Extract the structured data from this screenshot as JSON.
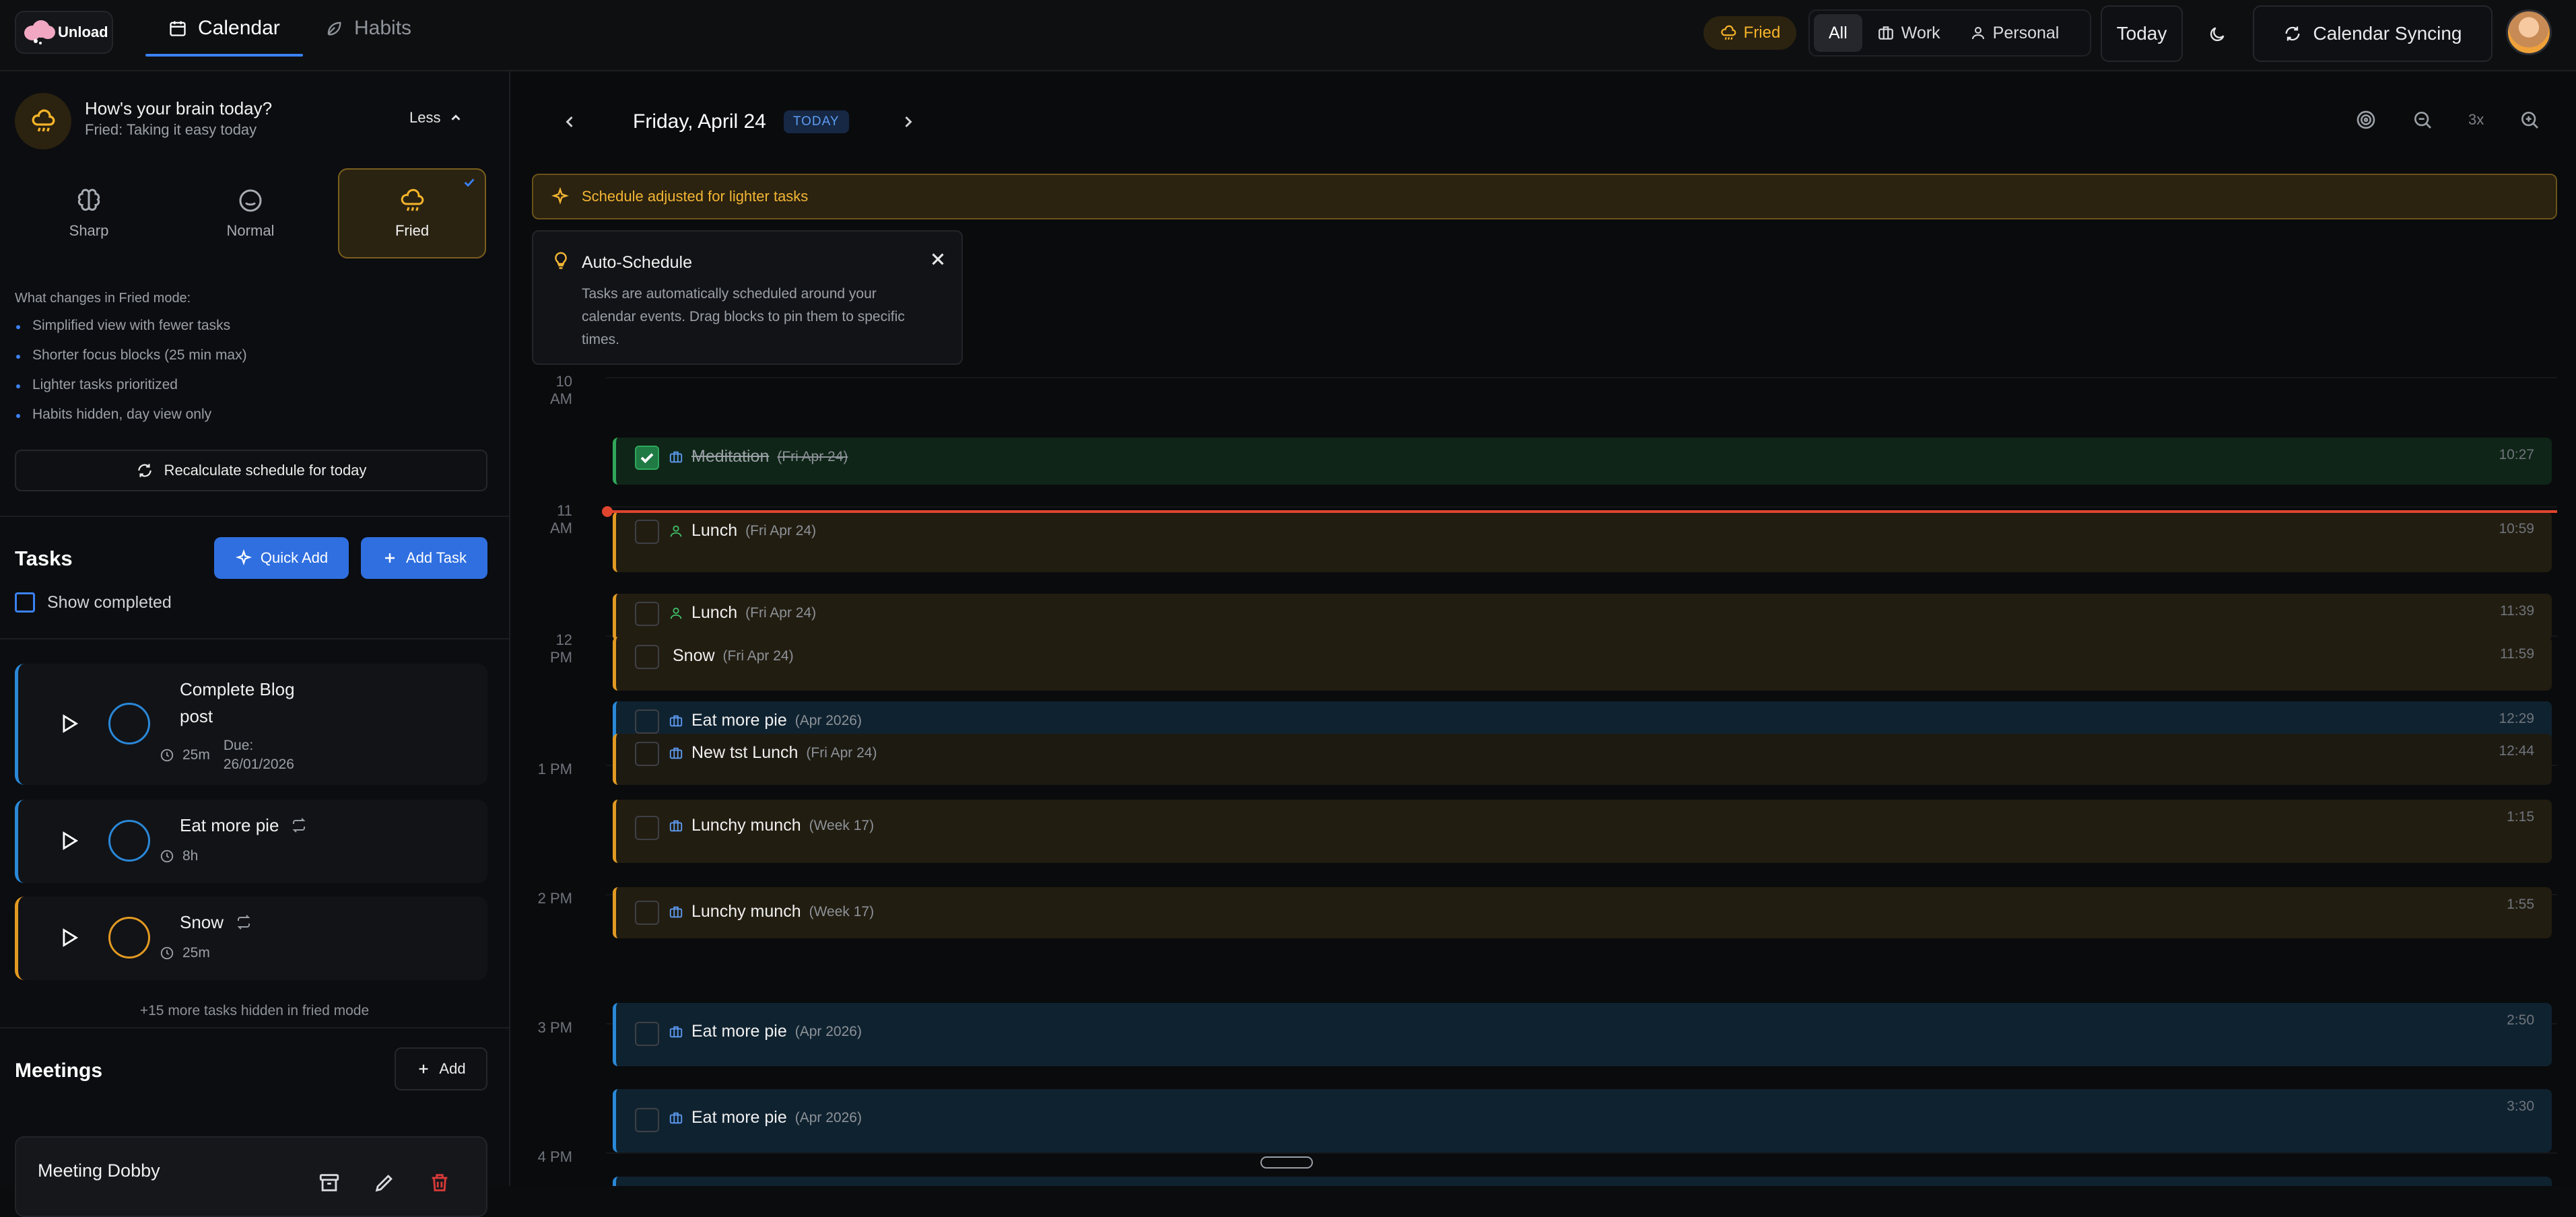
{
  "app": {
    "name": "Unload"
  },
  "nav": {
    "calendar": "Calendar",
    "habits": "Habits"
  },
  "header": {
    "mood_pill": "Fried",
    "filters": [
      "All",
      "Work",
      "Personal"
    ],
    "today": "Today",
    "sync": "Calendar Syncing"
  },
  "mood": {
    "question": "How's your brain today?",
    "status": "Fried: Taking it easy today",
    "toggle": "Less",
    "options": [
      "Sharp",
      "Normal",
      "Fried"
    ],
    "selected": "Fried",
    "changes_title": "What changes in Fried mode:",
    "changes": [
      "Simplified view with fewer tasks",
      "Shorter focus blocks (25 min max)",
      "Lighter tasks prioritized",
      "Habits hidden, day view only"
    ],
    "recalc": "Recalculate schedule for today"
  },
  "tasks": {
    "title": "Tasks",
    "quick_add": "Quick Add",
    "add_task": "Add Task",
    "show_completed": "Show completed",
    "items": [
      {
        "name_line1": "Complete Blog",
        "name_line2": "post",
        "duration": "25m",
        "due_label": "Due:",
        "due_date": "26/01/2026",
        "color": "#2a88d8"
      },
      {
        "name": "Eat more pie",
        "duration": "8h",
        "color": "#2a88d8"
      },
      {
        "name": "Snow",
        "duration": "25m",
        "color": "#e29a22"
      }
    ],
    "hidden_note": "+15 more tasks hidden in fried mode"
  },
  "meetings": {
    "title": "Meetings",
    "add": "Add",
    "items": [
      {
        "name": "Meeting Dobby"
      }
    ]
  },
  "calendar": {
    "date": "Friday, April 24",
    "today_badge": "TODAY",
    "zoom_level": "3x",
    "banner": "Schedule adjusted for lighter tasks",
    "auto_title": "Auto-Schedule",
    "auto_body": "Tasks are automatically scheduled around your calendar events. Drag blocks to pin them to specific times.",
    "hours": [
      "10 AM",
      "11 AM",
      "12 PM",
      "1 PM",
      "2 PM",
      "3 PM",
      "4 PM"
    ],
    "events": [
      {
        "title": "Meditation",
        "sub": "(Fri Apr 24)",
        "time": "10:27",
        "kind": "work",
        "done": true
      },
      {
        "title": "Lunch",
        "sub": "(Fri Apr 24)",
        "time": "10:59",
        "kind": "personal"
      },
      {
        "title": "Lunch",
        "sub": "(Fri Apr 24)",
        "time": "11:39",
        "kind": "personal"
      },
      {
        "title": "Snow",
        "sub": "(Fri Apr 24)",
        "time": "11:59",
        "kind": "none"
      },
      {
        "title": "Eat more pie",
        "sub": "(Apr 2026)",
        "time": "12:29",
        "kind": "work"
      },
      {
        "title": "New tst Lunch",
        "sub": "(Fri Apr 24)",
        "time": "12:44",
        "kind": "work"
      },
      {
        "title": "Lunchy munch",
        "sub": "(Week 17)",
        "time": "1:15",
        "kind": "work"
      },
      {
        "title": "Lunchy munch",
        "sub": "(Week 17)",
        "time": "1:55",
        "kind": "work"
      },
      {
        "title": "Eat more pie",
        "sub": "(Apr 2026)",
        "time": "2:50",
        "kind": "work"
      },
      {
        "title": "Eat more pie",
        "sub": "(Apr 2026)",
        "time": "3:30",
        "kind": "work"
      }
    ]
  }
}
